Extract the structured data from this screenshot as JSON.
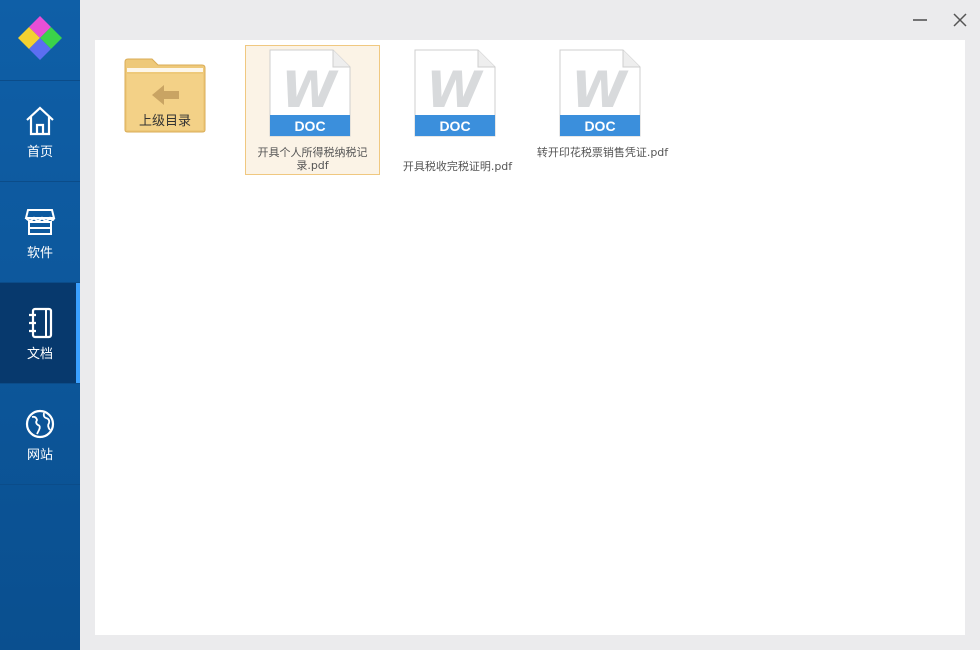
{
  "sidebar": {
    "items": [
      {
        "label": "首页",
        "icon": "home-icon"
      },
      {
        "label": "软件",
        "icon": "store-icon"
      },
      {
        "label": "文档",
        "icon": "notebook-icon",
        "active": true
      },
      {
        "label": "网站",
        "icon": "globe-icon"
      }
    ]
  },
  "window": {
    "minimize_icon": "minimize-icon",
    "close_icon": "close-icon"
  },
  "files": {
    "parent": {
      "label": "上级目录",
      "icon": "folder-back-icon"
    },
    "items": [
      {
        "name": "开具个人所得税纳税记录.pdf",
        "badge": "DOC",
        "selected": true
      },
      {
        "name": "开具税收完税证明.pdf",
        "badge": "DOC",
        "selected": false
      },
      {
        "name": "转开印花税票销售凭证.pdf",
        "badge": "DOC",
        "selected": false
      }
    ]
  },
  "colors": {
    "sidebar": "#0f5fa7",
    "active": "#07396d",
    "accent": "#3aa0ff",
    "doc_badge": "#3b8fdc",
    "selection": "#fbf3e6"
  }
}
